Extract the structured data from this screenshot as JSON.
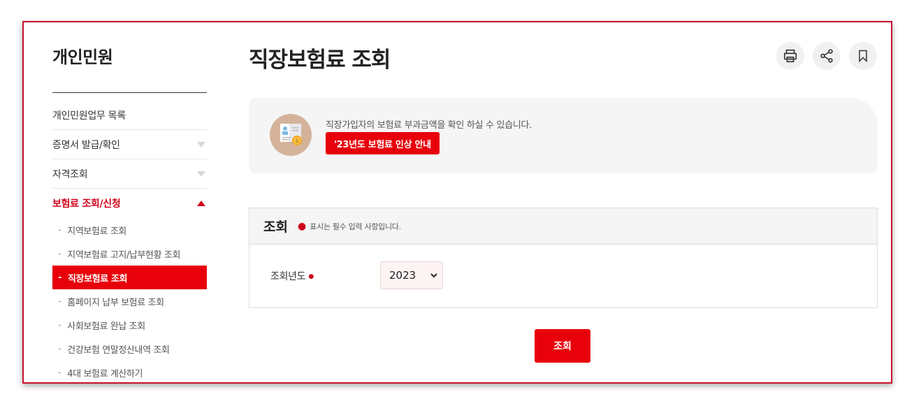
{
  "sidebar": {
    "title": "개인민원",
    "items": [
      {
        "label": "개인민원업무 목록"
      },
      {
        "label": "증명서 발급/확인"
      },
      {
        "label": "자격조회"
      },
      {
        "label": "보험료 조회/신청"
      }
    ],
    "subitems": [
      {
        "label": "지역보험료 조회"
      },
      {
        "label": "지역보험료 고지/납부현황 조회"
      },
      {
        "label": "직장보험료 조회"
      },
      {
        "label": "홈페이지 납부 보험료 조회"
      },
      {
        "label": "사회보험료 완납 조회"
      },
      {
        "label": "건강보험 연말정산내역 조회"
      },
      {
        "label": "4대 보험료 계산하기"
      }
    ]
  },
  "main": {
    "title": "직장보험료 조회",
    "info": {
      "text": "직장가입자의 보험료 부과금액을 확인 하실 수 있습니다.",
      "badge": "'23년도 보험료 인상 안내"
    },
    "query": {
      "title": "조회",
      "note": "표시는 필수 입력 사항입니다.",
      "year_label": "조회년도",
      "year_value": "2023"
    },
    "submit_label": "조회"
  },
  "colors": {
    "accent": "#e8000b",
    "frame": "#c8102e"
  }
}
